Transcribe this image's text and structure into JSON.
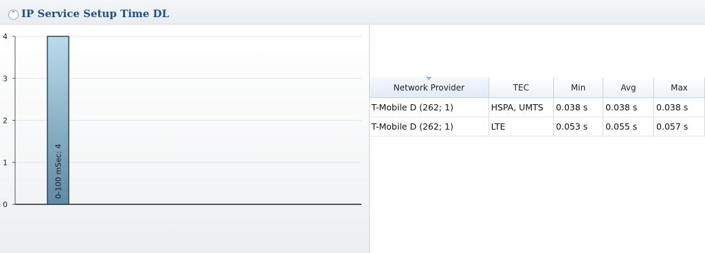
{
  "header": {
    "title": "IP Service Setup Time DL",
    "collapse_icon": "double-chevron-up-icon"
  },
  "chart_data": {
    "type": "bar",
    "orientation": "vertical",
    "categories": [
      "0-100 mSec"
    ],
    "values": [
      4
    ],
    "data_labels": [
      "0-100 mSec: 4"
    ],
    "ylim": [
      0,
      4
    ],
    "yticks": [
      "0",
      "1",
      "2",
      "3",
      "4"
    ],
    "grid": true,
    "colors": {
      "bar_fill_top": "#b9dcea",
      "bar_fill_bottom": "#5f8aa5",
      "bar_stroke": "#2f4254",
      "grid": "#dfe3e7",
      "axis": "#555555"
    }
  },
  "table": {
    "columns": [
      "Network Provider",
      "TEC",
      "Min",
      "Avg",
      "Max"
    ],
    "rows": [
      [
        "T-Mobile D (262; 1)",
        "HSPA, UMTS",
        "0.038 s",
        "0.038 s",
        "0.038 s"
      ],
      [
        "T-Mobile D (262; 1)",
        "LTE",
        "0.053 s",
        "0.055 s",
        "0.057 s"
      ]
    ],
    "sorted_column": "Network Provider"
  }
}
